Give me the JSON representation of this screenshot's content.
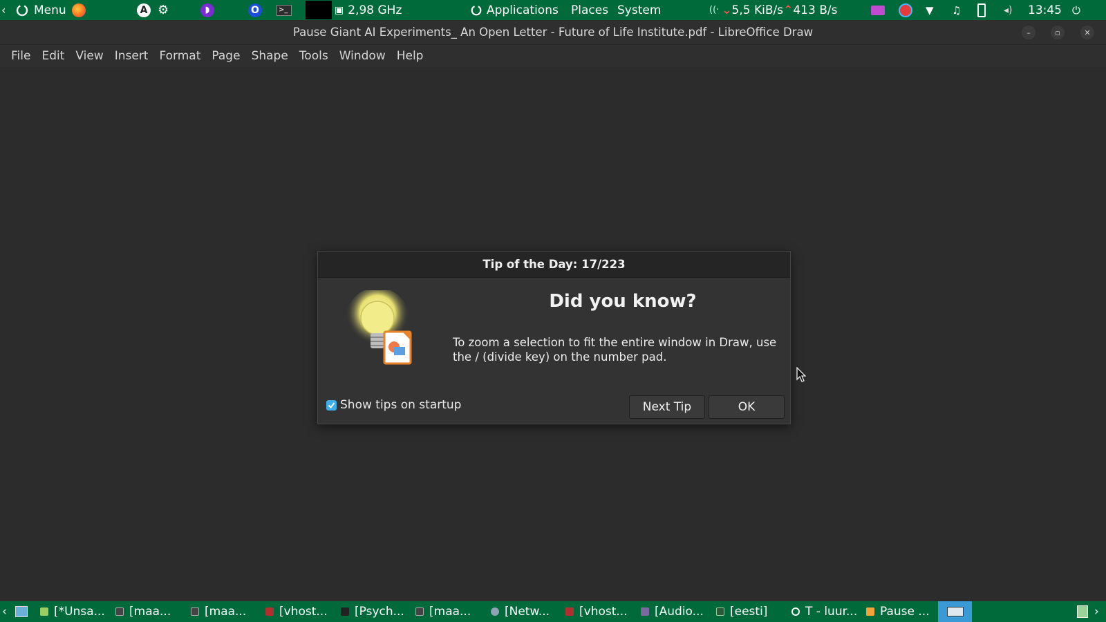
{
  "top_panel": {
    "menu_label": "Menu",
    "cpu_freq": "2,98 GHz",
    "applications": "Applications",
    "places": "Places",
    "system": "System",
    "net_down": "5,5 KiB/s",
    "net_up": "413 B/s",
    "clock": "13:45"
  },
  "window": {
    "title": "Pause Giant AI Experiments_ An Open Letter - Future of Life Institute.pdf - LibreOffice Draw"
  },
  "menu": {
    "items": [
      "File",
      "Edit",
      "View",
      "Insert",
      "Format",
      "Page",
      "Shape",
      "Tools",
      "Window",
      "Help"
    ]
  },
  "dialog": {
    "title": "Tip of the Day: 17/223",
    "heading": "Did you know?",
    "text": "To zoom a selection to fit the entire window in Draw, use the / (divide key) on the number pad.",
    "checkbox_label": "Show tips on startup",
    "checkbox_checked": true,
    "next_button": "Next Tip",
    "ok_button": "OK"
  },
  "taskbar": {
    "items": [
      "[*Unsa...",
      "[maa...",
      "[maa...",
      "[vhost...",
      "[Psych...",
      "[maa...",
      "[Netw...",
      "[vhost...",
      "[Audio...",
      "[eesti]",
      "T - luur...",
      "Pause ..."
    ]
  },
  "colors": {
    "panel_green": "#006a3a",
    "accent_blue": "#3daee9",
    "workspace_bg": "#2c2c2c"
  }
}
